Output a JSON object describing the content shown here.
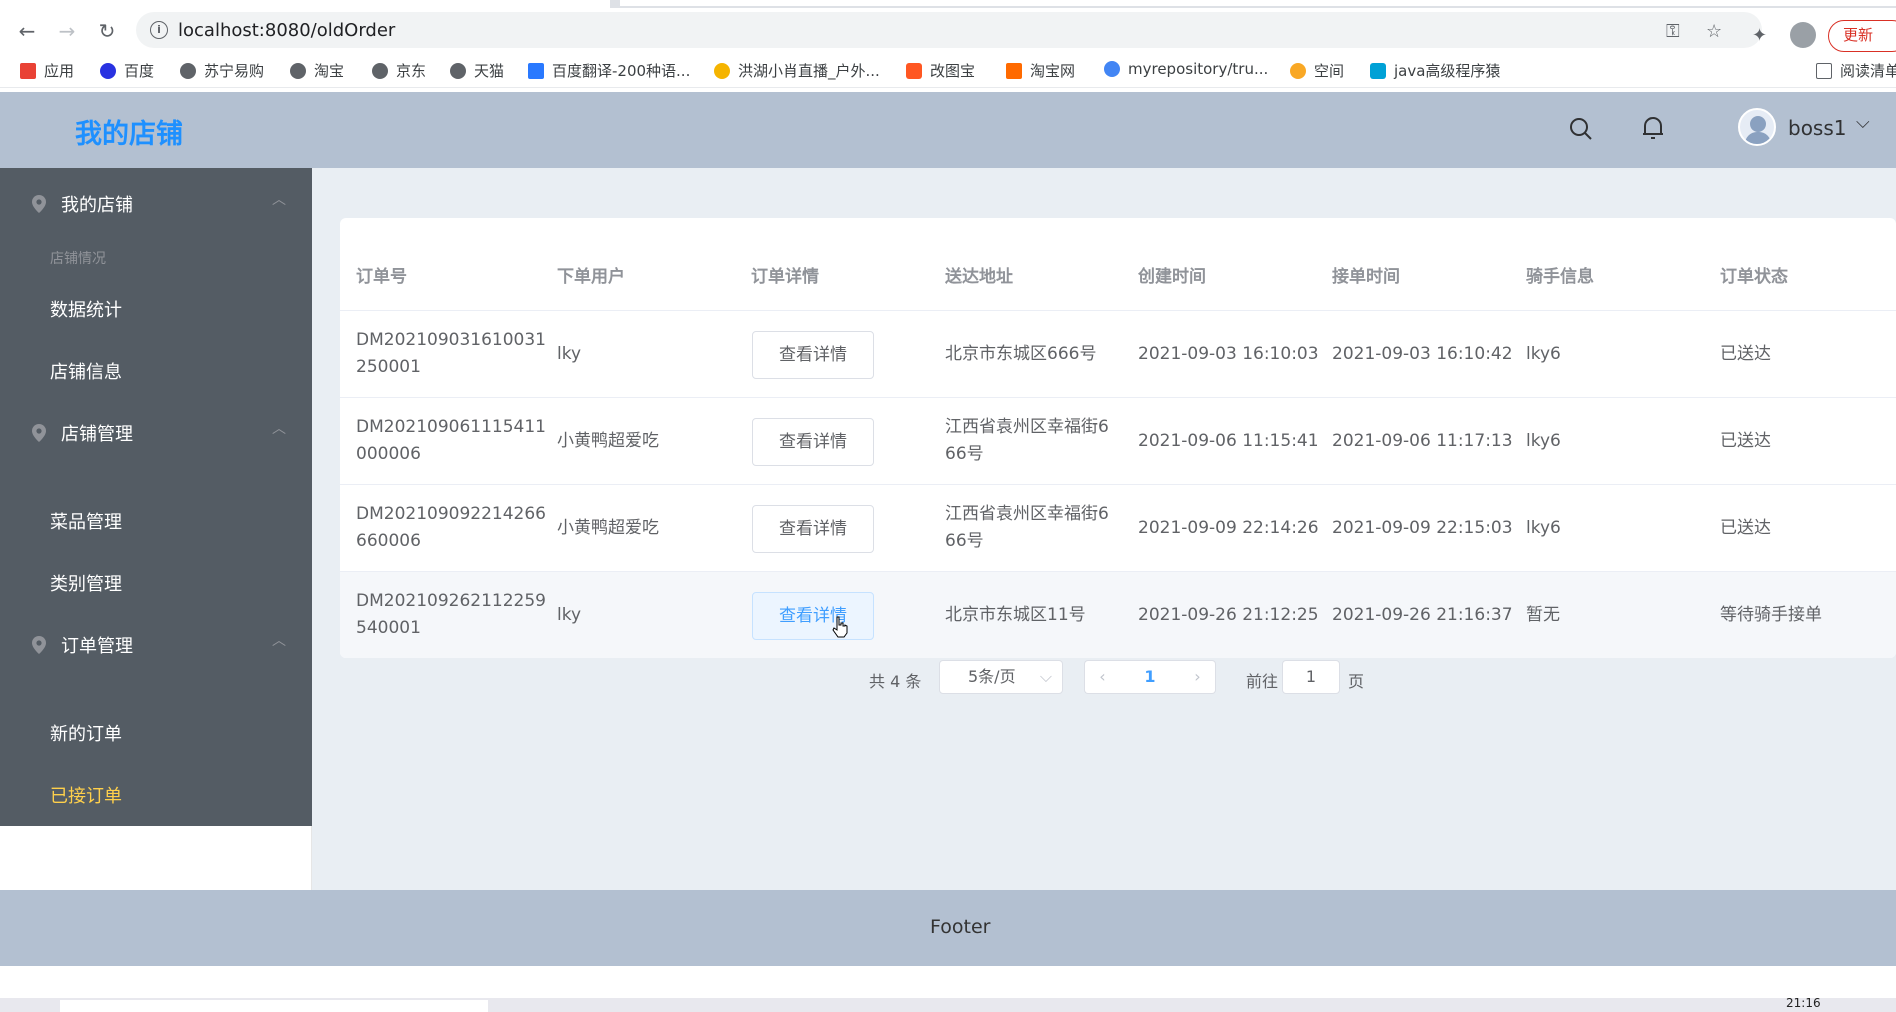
{
  "browser": {
    "url": "localhost:8080/oldOrder",
    "update_label": "更新",
    "bookmarks": [
      "应用",
      "百度",
      "苏宁易购",
      "淘宝",
      "京东",
      "天猫",
      "百度翻译-200种语...",
      "洪湖小肖直播_户外...",
      "改图宝",
      "淘宝网",
      "myrepository/tru...",
      "空间",
      "java高级程序猿",
      "阅读清单"
    ]
  },
  "header": {
    "brand": "我的店铺",
    "username": "boss1"
  },
  "sidebar": {
    "group1": {
      "title": "我的店铺",
      "sub_label": "店铺情况",
      "items": [
        "数据统计",
        "店铺信息"
      ]
    },
    "group2": {
      "title": "店铺管理",
      "items": [
        "菜品管理",
        "类别管理"
      ]
    },
    "group3": {
      "title": "订单管理",
      "items": [
        "新的订单",
        "已接订单"
      ]
    }
  },
  "table": {
    "columns": [
      "订单号",
      "下单用户",
      "订单详情",
      "送达地址",
      "创建时间",
      "接单时间",
      "骑手信息",
      "订单状态"
    ],
    "detail_label": "查看详情",
    "rows": [
      {
        "id_line1": "DM202109031610031",
        "id_line2": "250001",
        "user": "lky",
        "addr_line1": "北京市东城区666号",
        "addr_line2": "",
        "created": "2021-09-03 16:10:03",
        "accepted": "2021-09-03 16:10:42",
        "rider": "lky6",
        "status": "已送达"
      },
      {
        "id_line1": "DM202109061115411",
        "id_line2": "000006",
        "user": "小黄鸭超爱吃",
        "addr_line1": "江西省袁州区幸福街6",
        "addr_line2": "66号",
        "created": "2021-09-06 11:15:41",
        "accepted": "2021-09-06 11:17:13",
        "rider": "lky6",
        "status": "已送达"
      },
      {
        "id_line1": "DM202109092214266",
        "id_line2": "660006",
        "user": "小黄鸭超爱吃",
        "addr_line1": "江西省袁州区幸福街6",
        "addr_line2": "66号",
        "created": "2021-09-09 22:14:26",
        "accepted": "2021-09-09 22:15:03",
        "rider": "lky6",
        "status": "已送达"
      },
      {
        "id_line1": "DM202109262112259",
        "id_line2": "540001",
        "user": "lky",
        "addr_line1": "北京市东城区11号",
        "addr_line2": "",
        "created": "2021-09-26 21:12:25",
        "accepted": "2021-09-26 21:16:37",
        "rider": "暂无",
        "status": "等待骑手接单"
      }
    ]
  },
  "pager": {
    "total": "共 4 条",
    "page_size": "5条/页",
    "current": "1",
    "goto_label": "前往",
    "goto_value": "1",
    "page_suffix": "页"
  },
  "footer": {
    "text": "Footer"
  },
  "taskbar": {
    "clock": "21:16"
  },
  "colors": {
    "header_bg": "#b3c0d1",
    "sidebar_bg": "#545c64",
    "active_menu": "#ffd04b",
    "brand": "#1e90ff",
    "main_bg": "#e9eef3"
  }
}
